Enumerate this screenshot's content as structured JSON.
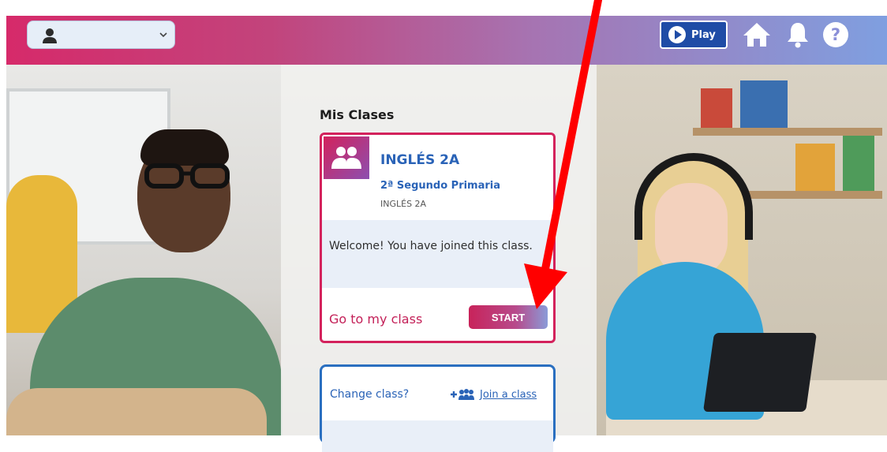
{
  "header": {
    "user_select_value": "",
    "play_label": "Play"
  },
  "main": {
    "section_title": "Mis Clases",
    "class_card": {
      "name": "INGLÉS 2A",
      "grade": "2ª Segundo Primaria",
      "subtitle": "INGLÉS 2A",
      "welcome": "Welcome! You have joined this class.",
      "go_to": "Go to my class",
      "start_label": "START"
    },
    "change_card": {
      "question": "Change class?",
      "join_label": "Join a class"
    }
  },
  "colors": {
    "accent_pink": "#d3225c",
    "accent_blue": "#2a63b7",
    "annotation_arrow": "#ff0000"
  },
  "icons": [
    "person-icon",
    "chevron-down-icon",
    "play-icon",
    "home-icon",
    "bell-icon",
    "help-icon",
    "group-icon",
    "add-group-icon"
  ]
}
